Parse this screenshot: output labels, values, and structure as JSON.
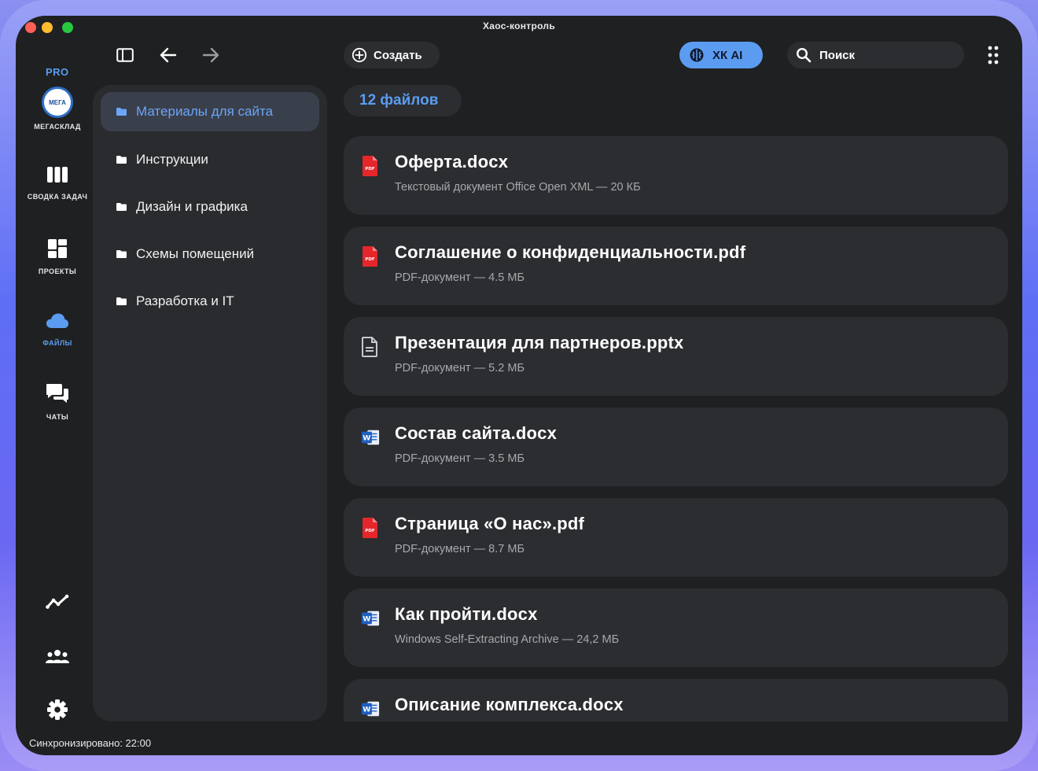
{
  "window": {
    "title": "Хаос-контроль"
  },
  "rail": {
    "badge": "PRO",
    "items": [
      {
        "label": "МЕГАСКЛАД",
        "icon": "megasklad-logo",
        "logo_text": "МЕГА"
      },
      {
        "label": "СВОДКА ЗАДАЧ",
        "icon": "columns-icon"
      },
      {
        "label": "ПРОЕКТЫ",
        "icon": "dashboard-icon"
      },
      {
        "label": "ФАЙЛЫ",
        "icon": "cloud-icon",
        "active": true
      },
      {
        "label": "ЧАТЫ",
        "icon": "chat-icon"
      }
    ],
    "bottom_icons": [
      "analytics-icon",
      "team-icon",
      "settings-icon"
    ]
  },
  "toolbar": {
    "create_label": "Создать",
    "ai_label": "ХК AI",
    "search_label": "Поиск"
  },
  "folders": [
    {
      "label": "Материалы для сайта",
      "active": true
    },
    {
      "label": "Инструкции"
    },
    {
      "label": "Дизайн и графика"
    },
    {
      "label": "Схемы помещений"
    },
    {
      "label": "Разработка и IT"
    }
  ],
  "files_count": "12 файлов",
  "files": [
    {
      "name": "Оферта.docx",
      "meta": "Текстовый документ Office Open XML — 20 КБ",
      "icon": "pdf-icon"
    },
    {
      "name": "Соглашение о конфиденциальности.pdf",
      "meta": "PDF-документ — 4.5 МБ",
      "icon": "pdf-icon"
    },
    {
      "name": "Презентация для партнеров.pptx",
      "meta": "PDF-документ — 5.2 МБ",
      "icon": "document-icon"
    },
    {
      "name": "Состав сайта.docx",
      "meta": "PDF-документ — 3.5 МБ",
      "icon": "word-icon"
    },
    {
      "name": "Страница «О нас».pdf",
      "meta": "PDF-документ — 8.7 МБ",
      "icon": "pdf-icon"
    },
    {
      "name": "Как пройти.docx",
      "meta": "Windows Self-Extracting Archive — 24,2 МБ",
      "icon": "word-icon"
    },
    {
      "name": "Описание комплекса.docx",
      "meta": "",
      "icon": "word-icon"
    }
  ],
  "status": "Синхронизировано: 22:00",
  "colors": {
    "accent": "#5b9cf0",
    "background": "#1f2022",
    "card": "#2c2d30",
    "panel": "#2a2b2e",
    "pdf_red": "#e5262b",
    "word_blue": "#1f5fbf"
  }
}
